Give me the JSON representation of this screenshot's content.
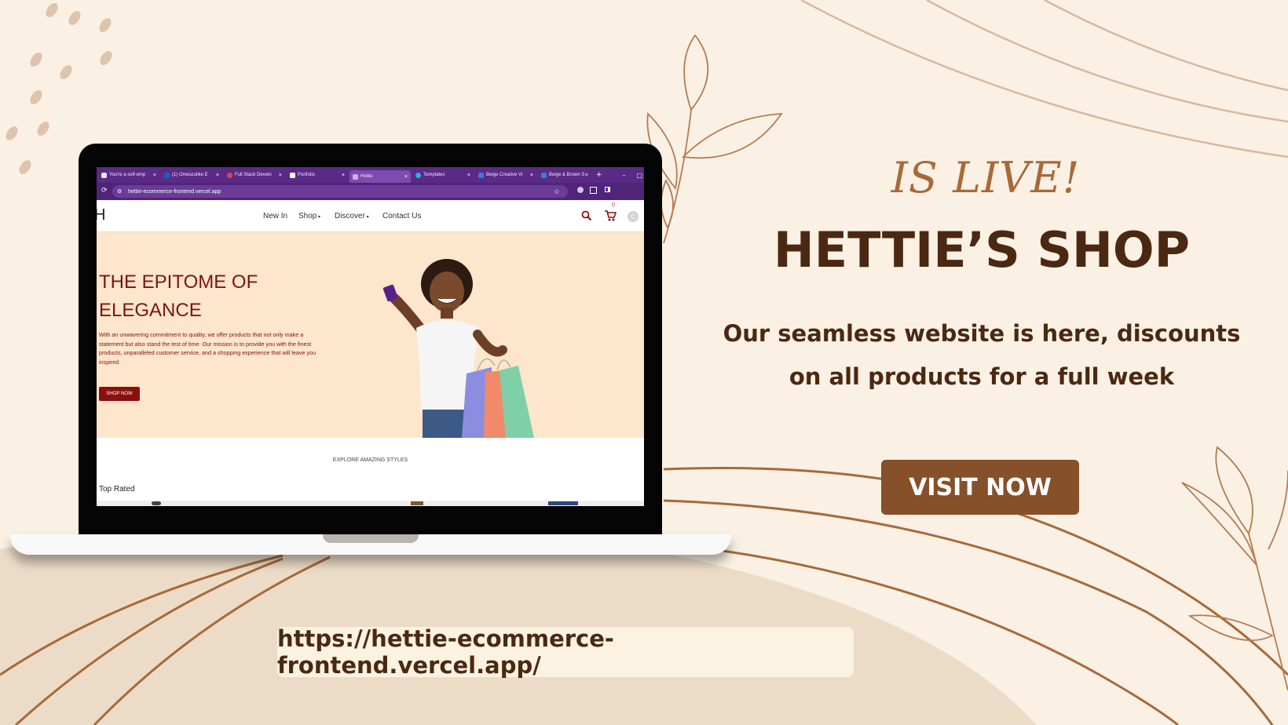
{
  "promo": {
    "tagline": "IS LIVE!",
    "title": "HETTIE’S SHOP",
    "line1": "Our seamless website is here, discounts",
    "line2": "on all products for a full week",
    "button": "VISIT NOW",
    "url": "https://hettie-ecommerce-frontend.vercel.app/"
  },
  "browser": {
    "tabs": [
      {
        "label": "You're a self-emp",
        "fav": "#e8e8e8"
      },
      {
        "label": "(1) Onwuzulike E",
        "fav": "#0a66c2"
      },
      {
        "label": "Full Stack Develo",
        "fav": "#e04444"
      },
      {
        "label": "Portfolio",
        "fav": "#ffffff"
      },
      {
        "label": "Hettie",
        "fav": "#c9b3e6"
      },
      {
        "label": "Templates",
        "fav": "#1fb5e0"
      },
      {
        "label": "Beige Creative Vi",
        "fav": "#3a7bd5"
      },
      {
        "label": "Beige & Brown S",
        "fav": "#3a7bd5"
      }
    ],
    "new_tab": "+",
    "address": "hettie-ecommerce-frontend.vercel.app",
    "window_min": "–",
    "window_max": "□"
  },
  "site": {
    "logo": "H",
    "nav": [
      "New In",
      "Shop",
      "Discover",
      "Contact Us"
    ],
    "cart_count": "0",
    "avatar": "C",
    "hero_title_1": "THE EPITOME OF",
    "hero_title_2": "ELEGANCE",
    "hero_text": "With an unwavering commitment to quality, we offer products that not only make a statement but also stand the test of time. Our mission is to provide you with the finest products, unparalleled customer service, and a shopping experience that will leave you inspired.",
    "shop_now": "SHOP NOW",
    "explore": "EXPLORE AMAZING STYLES",
    "top_rated": "Top Rated"
  },
  "colors": {
    "background": "#faf1e4",
    "brown_dark": "#4b2812",
    "brown_button": "#85502a",
    "accent_script": "#a8693a",
    "browser_purple": "#5b2a86",
    "hero_bg": "#fde6cb",
    "hero_red": "#7d1212"
  }
}
